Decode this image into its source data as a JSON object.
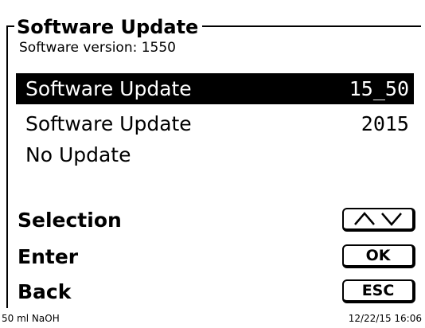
{
  "screen": {
    "title": "Software Update",
    "subtitle": "Software version: 1550"
  },
  "menu": {
    "items": [
      {
        "label": "Software Update",
        "value": "15_50",
        "selected": true
      },
      {
        "label": "Software Update",
        "value": "2015",
        "selected": false
      },
      {
        "label": "No Update",
        "value": "",
        "selected": false
      }
    ]
  },
  "functions": {
    "selection": {
      "label": "Selection",
      "key_icons": [
        "caret-up-icon",
        "caret-down-icon"
      ]
    },
    "enter": {
      "label": "Enter",
      "key_label": "OK"
    },
    "back": {
      "label": "Back",
      "key_label": "ESC"
    }
  },
  "status_bar": {
    "left": "50 ml NaOH",
    "right": "12/22/15 16:06"
  }
}
